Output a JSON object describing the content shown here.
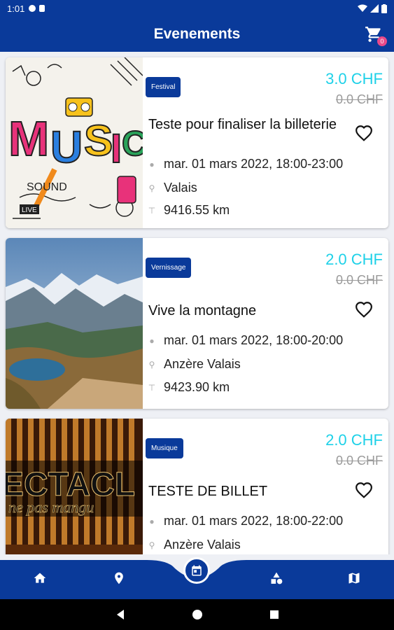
{
  "status": {
    "time": "1:01"
  },
  "header": {
    "title": "Evenements",
    "cart_count": "0"
  },
  "events": [
    {
      "category": "Festival",
      "price": "3.0 CHF",
      "old_price": "0.0 CHF",
      "title": "Teste pour finaliser la billeterie",
      "date": "mar. 01 mars 2022, 18:00-23:00",
      "location": " Valais",
      "distance": "9416.55 km",
      "image": "music-doodle"
    },
    {
      "category": "Vernissage",
      "price": "2.0 CHF",
      "old_price": "0.0 CHF",
      "title": "Vive la montagne",
      "date": "mar. 01 mars 2022, 18:00-20:00",
      "location": "Anzère Valais",
      "distance": "9423.90 km",
      "image": "mountain-lake"
    },
    {
      "category": "Musique",
      "price": "2.0 CHF",
      "old_price": "0.0 CHF",
      "title": "TESTE DE BILLET",
      "date": "mar. 01 mars 2022, 18:00-22:00",
      "location": "Anzère Valais",
      "distance": "",
      "image": "spectacle-curtain",
      "image_text": "ECTACL",
      "image_subtext": "ne pas mangu"
    }
  ],
  "bottom_nav": [
    "home-icon",
    "map-pin-icon",
    "calendar-icon",
    "categories-icon",
    "map-icon"
  ],
  "colors": {
    "primary": "#0a3a9a",
    "price": "#1ed1e8",
    "badge": "#e84a8a"
  }
}
